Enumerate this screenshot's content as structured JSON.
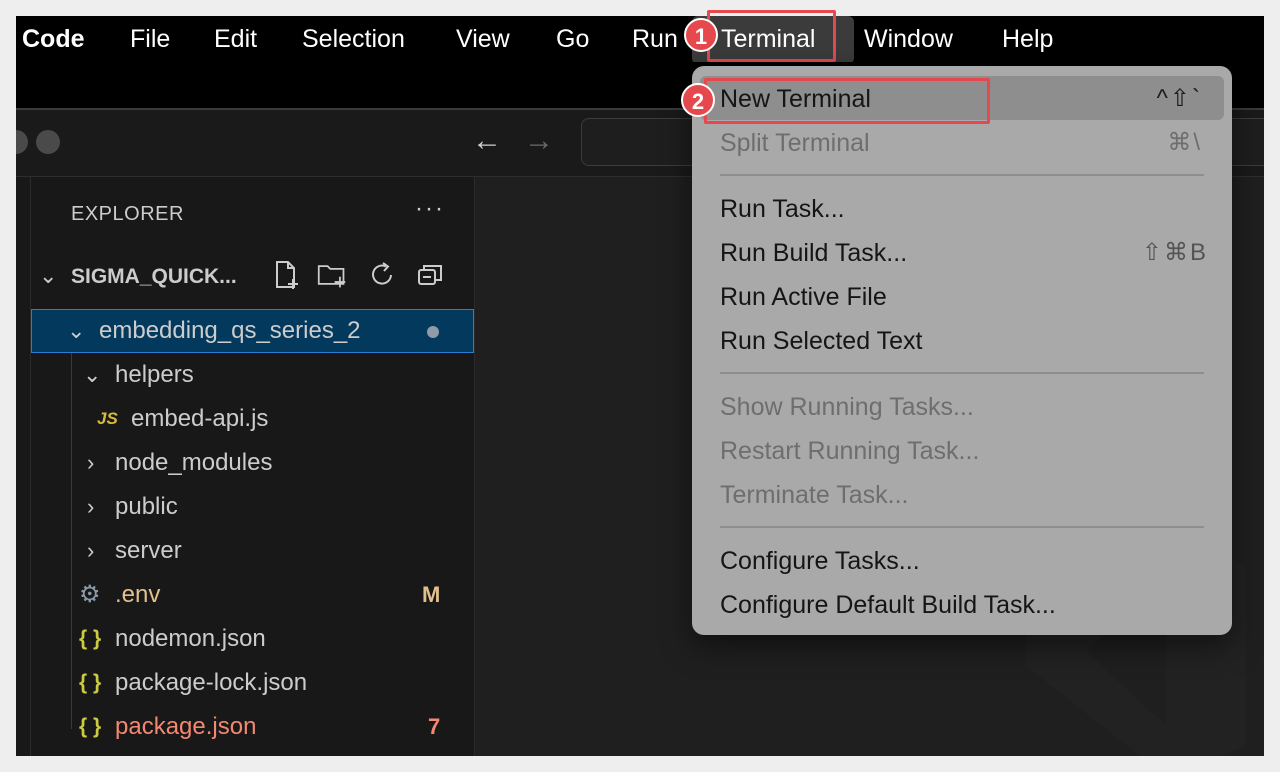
{
  "menubar": {
    "items": [
      "Code",
      "File",
      "Edit",
      "Selection",
      "View",
      "Go",
      "Run",
      "Terminal",
      "Window",
      "Help"
    ],
    "active": "Terminal"
  },
  "callouts": {
    "step1": "1",
    "step2": "2",
    "accent": "#e5484d"
  },
  "titlebar": {
    "back_icon": "arrow-left-icon",
    "forward_icon": "arrow-right-icon"
  },
  "explorer": {
    "title": "EXPLORER",
    "more": "···",
    "workspace": "SIGMA_QUICK...",
    "tree": [
      {
        "label": "embedding_qs_series_2",
        "type": "folder-open",
        "selected": true
      },
      {
        "label": "helpers",
        "type": "folder-open"
      },
      {
        "label": "embed-api.js",
        "type": "js",
        "icon": "JS"
      },
      {
        "label": "node_modules",
        "type": "folder"
      },
      {
        "label": "public",
        "type": "folder"
      },
      {
        "label": "server",
        "type": "folder"
      },
      {
        "label": ".env",
        "type": "config",
        "badge": "M",
        "badge_color": "#e2c08d"
      },
      {
        "label": "nodemon.json",
        "type": "json",
        "icon": "{ }"
      },
      {
        "label": "package-lock.json",
        "type": "json",
        "icon": "{ }"
      },
      {
        "label": "package.json",
        "type": "json",
        "icon": "{ }",
        "badge": "7",
        "badge_color": "#f14c4c"
      }
    ]
  },
  "terminal_menu": {
    "items": [
      {
        "label": "New Terminal",
        "shortcut": "^⇧`",
        "enabled": true,
        "highlighted": true
      },
      {
        "label": "Split Terminal",
        "shortcut": "⌘\\",
        "enabled": false
      },
      {
        "label": "Run Task...",
        "shortcut": "",
        "enabled": true
      },
      {
        "label": "Run Build Task...",
        "shortcut": "⇧⌘B",
        "enabled": true
      },
      {
        "label": "Run Active File",
        "shortcut": "",
        "enabled": true
      },
      {
        "label": "Run Selected Text",
        "shortcut": "",
        "enabled": true
      },
      {
        "label": "Show Running Tasks...",
        "shortcut": "",
        "enabled": false
      },
      {
        "label": "Restart Running Task...",
        "shortcut": "",
        "enabled": false
      },
      {
        "label": "Terminate Task...",
        "shortcut": "",
        "enabled": false
      },
      {
        "label": "Configure Tasks...",
        "shortcut": "",
        "enabled": true
      },
      {
        "label": "Configure Default Build Task...",
        "shortcut": "",
        "enabled": true
      }
    ]
  }
}
